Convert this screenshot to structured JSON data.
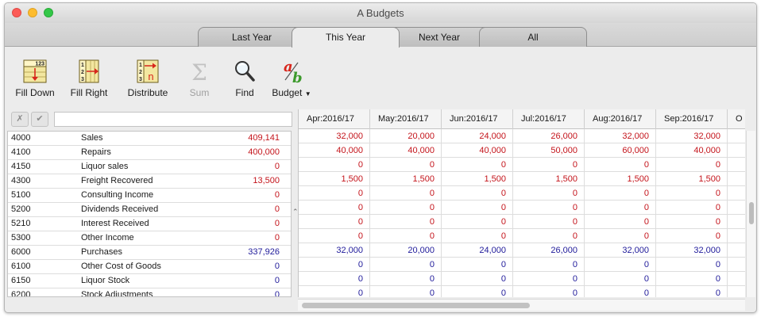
{
  "window": {
    "title": "A Budgets"
  },
  "colors": {
    "income": "#c4141b",
    "cost": "#1f1a9a"
  },
  "tabs": [
    {
      "label": "Last Year",
      "active": false
    },
    {
      "label": "This Year",
      "active": true
    },
    {
      "label": "Next Year",
      "active": false
    },
    {
      "label": "All",
      "active": false
    }
  ],
  "toolbar": {
    "fill_down": {
      "label": "Fill Down",
      "icon": "fill-down-icon",
      "badge": "123"
    },
    "fill_right": {
      "label": "Fill Right",
      "icon": "fill-right-icon",
      "digits": [
        "1",
        "2",
        "3"
      ]
    },
    "distribute": {
      "label": "Distribute",
      "icon": "distribute-icon",
      "digits": [
        "1",
        "2",
        "3"
      ],
      "letter": "n"
    },
    "sum": {
      "label": "Sum",
      "icon": "sigma-icon",
      "symbol": "Σ",
      "enabled": false
    },
    "find": {
      "label": "Find",
      "icon": "magnifier-icon"
    },
    "budget": {
      "label": "Budget",
      "icon": "budget-ab-icon",
      "letters": [
        "a",
        "b"
      ],
      "has_menu": true
    }
  },
  "filter": {
    "cancel_glyph": "✗",
    "accept_glyph": "✔",
    "value": "",
    "placeholder": ""
  },
  "accounts": [
    {
      "code": "4000",
      "name": "Sales",
      "total": "409,141",
      "kind": "income"
    },
    {
      "code": "4100",
      "name": "Repairs",
      "total": "400,000",
      "kind": "income"
    },
    {
      "code": "4150",
      "name": "Liquor sales",
      "total": "0",
      "kind": "income"
    },
    {
      "code": "4300",
      "name": "Freight Recovered",
      "total": "13,500",
      "kind": "income"
    },
    {
      "code": "5100",
      "name": "Consulting Income",
      "total": "0",
      "kind": "income"
    },
    {
      "code": "5200",
      "name": "Dividends Received",
      "total": "0",
      "kind": "income"
    },
    {
      "code": "5210",
      "name": "Interest Received",
      "total": "0",
      "kind": "income"
    },
    {
      "code": "5300",
      "name": "Other Income",
      "total": "0",
      "kind": "income"
    },
    {
      "code": "6000",
      "name": "Purchases",
      "total": "337,926",
      "kind": "cost"
    },
    {
      "code": "6100",
      "name": "Other Cost of Goods",
      "total": "0",
      "kind": "cost"
    },
    {
      "code": "6150",
      "name": "Liquor Stock",
      "total": "0",
      "kind": "cost"
    },
    {
      "code": "6200",
      "name": "Stock Adjustments",
      "total": "0",
      "kind": "cost"
    }
  ],
  "grid": {
    "columns": [
      "Apr:2016/17",
      "May:2016/17",
      "Jun:2016/17",
      "Jul:2016/17",
      "Aug:2016/17",
      "Sep:2016/17",
      "O"
    ],
    "rows": [
      {
        "kind": "income",
        "values": [
          "32,000",
          "20,000",
          "24,000",
          "26,000",
          "32,000",
          "32,000"
        ]
      },
      {
        "kind": "income",
        "values": [
          "40,000",
          "40,000",
          "40,000",
          "50,000",
          "60,000",
          "40,000"
        ]
      },
      {
        "kind": "income",
        "values": [
          "0",
          "0",
          "0",
          "0",
          "0",
          "0"
        ]
      },
      {
        "kind": "income",
        "values": [
          "1,500",
          "1,500",
          "1,500",
          "1,500",
          "1,500",
          "1,500"
        ]
      },
      {
        "kind": "income",
        "values": [
          "0",
          "0",
          "0",
          "0",
          "0",
          "0"
        ]
      },
      {
        "kind": "income",
        "values": [
          "0",
          "0",
          "0",
          "0",
          "0",
          "0"
        ]
      },
      {
        "kind": "income",
        "values": [
          "0",
          "0",
          "0",
          "0",
          "0",
          "0"
        ]
      },
      {
        "kind": "income",
        "values": [
          "0",
          "0",
          "0",
          "0",
          "0",
          "0"
        ]
      },
      {
        "kind": "cost",
        "values": [
          "32,000",
          "20,000",
          "24,000",
          "26,000",
          "32,000",
          "32,000"
        ]
      },
      {
        "kind": "cost",
        "values": [
          "0",
          "0",
          "0",
          "0",
          "0",
          "0"
        ]
      },
      {
        "kind": "cost",
        "values": [
          "0",
          "0",
          "0",
          "0",
          "0",
          "0"
        ]
      },
      {
        "kind": "cost",
        "values": [
          "0",
          "0",
          "0",
          "0",
          "0",
          "0"
        ]
      }
    ]
  }
}
